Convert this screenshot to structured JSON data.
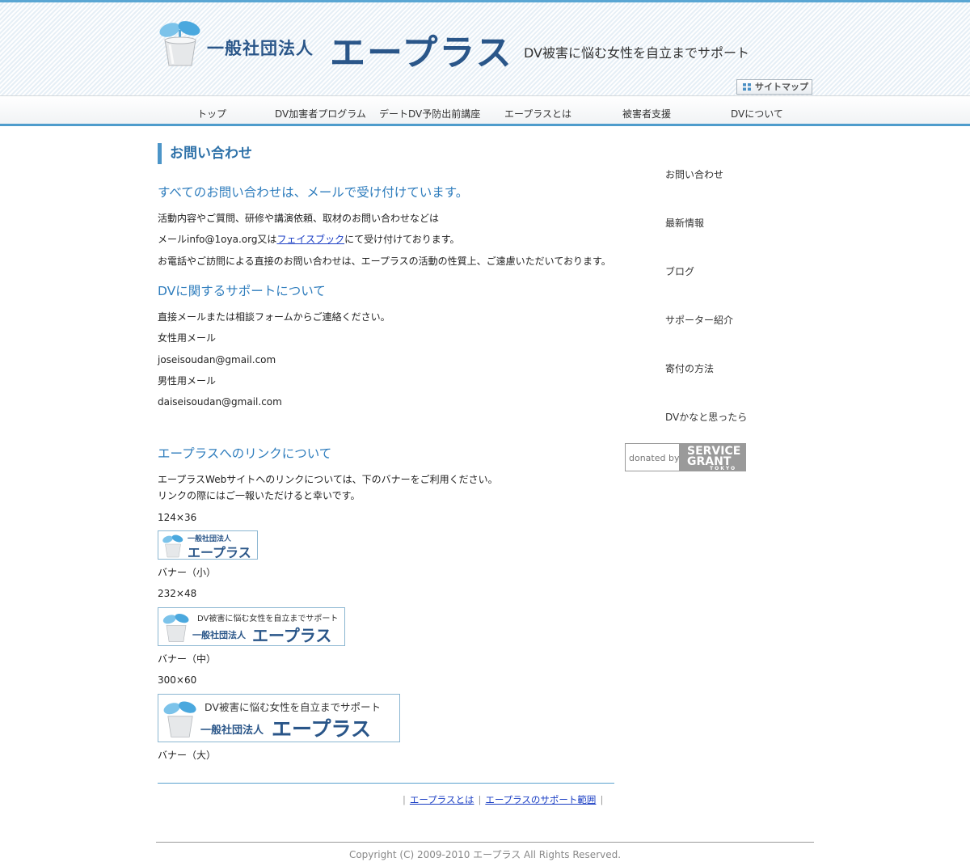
{
  "header": {
    "org_prefix": "一般社団法人",
    "org_name": "エープラス",
    "tagline": "DV被害に悩む女性を自立までサポート",
    "sitemap_label": "サイトマップ"
  },
  "nav": {
    "items": [
      {
        "label": "トップ"
      },
      {
        "label": "DV加害者プログラム"
      },
      {
        "label": "デートDV予防出前講座"
      },
      {
        "label": "エープラスとは"
      },
      {
        "label": "被害者支援"
      },
      {
        "label": "DVについて"
      }
    ]
  },
  "main": {
    "page_title": "お問い合わせ",
    "section1": {
      "heading": "すべてのお問い合わせは、メールで受け付けています。",
      "line1": "活動内容やご質問、研修や講演依頼、取材のお問い合わせなどは",
      "line2_prefix": "メールinfo@1oya.org又は",
      "line2_link": "フェイスブック",
      "line2_suffix": "にて受け付けております。",
      "line3": "お電話やご訪問による直接のお問い合わせは、エープラスの活動の性質上、ご遠慮いただいております。"
    },
    "section2": {
      "heading": "DVに関するサポートについて",
      "line1": "直接メールまたは相談フォームからご連絡ください。",
      "female_label": "女性用メール",
      "female_email": "joseisoudan@gmail.com",
      "male_label": "男性用メール",
      "male_email": "daiseisoudan@gmail.com"
    },
    "section3": {
      "heading": "エープラスへのリンクについて",
      "line1": "エープラスWebサイトへのリンクについては、下のバナーをご利用ください。",
      "line2": "リンクの際にはご一報いただけると幸いです。",
      "banners": [
        {
          "size_label": "124×36",
          "caption": "バナー（小）",
          "sub": "",
          "small": "一般社団法人",
          "big": "エープラス"
        },
        {
          "size_label": "232×48",
          "caption": "バナー（中）",
          "sub": "DV被害に悩む女性を自立までサポート",
          "small": "一般社団法人",
          "big": "エープラス"
        },
        {
          "size_label": "300×60",
          "caption": "バナー（大）",
          "sub": "DV被害に悩む女性を自立までサポート",
          "small": "一般社団法人",
          "big": "エープラス"
        }
      ]
    },
    "bottom_links": [
      "エープラスとは",
      "エープラスのサポート範囲"
    ]
  },
  "sidebar": {
    "items": [
      {
        "label": "お問い合わせ"
      },
      {
        "label": "最新情報"
      },
      {
        "label": "ブログ"
      },
      {
        "label": "サポーター紹介"
      },
      {
        "label": "寄付の方法"
      },
      {
        "label": "DVかなと思ったら"
      }
    ],
    "donated_label": "donated by",
    "donated_brand_1": "SERVICE",
    "donated_brand_2": "GRANT",
    "donated_brand_3": "TOKYO"
  },
  "footer": {
    "copyright": "Copyright (C) 2009-2010 エープラス All Rights Reserved."
  },
  "colors": {
    "accent": "#4e9ccc",
    "heading": "#2f7dbd",
    "logo": "#2a5689",
    "link": "#1a3ec4"
  }
}
